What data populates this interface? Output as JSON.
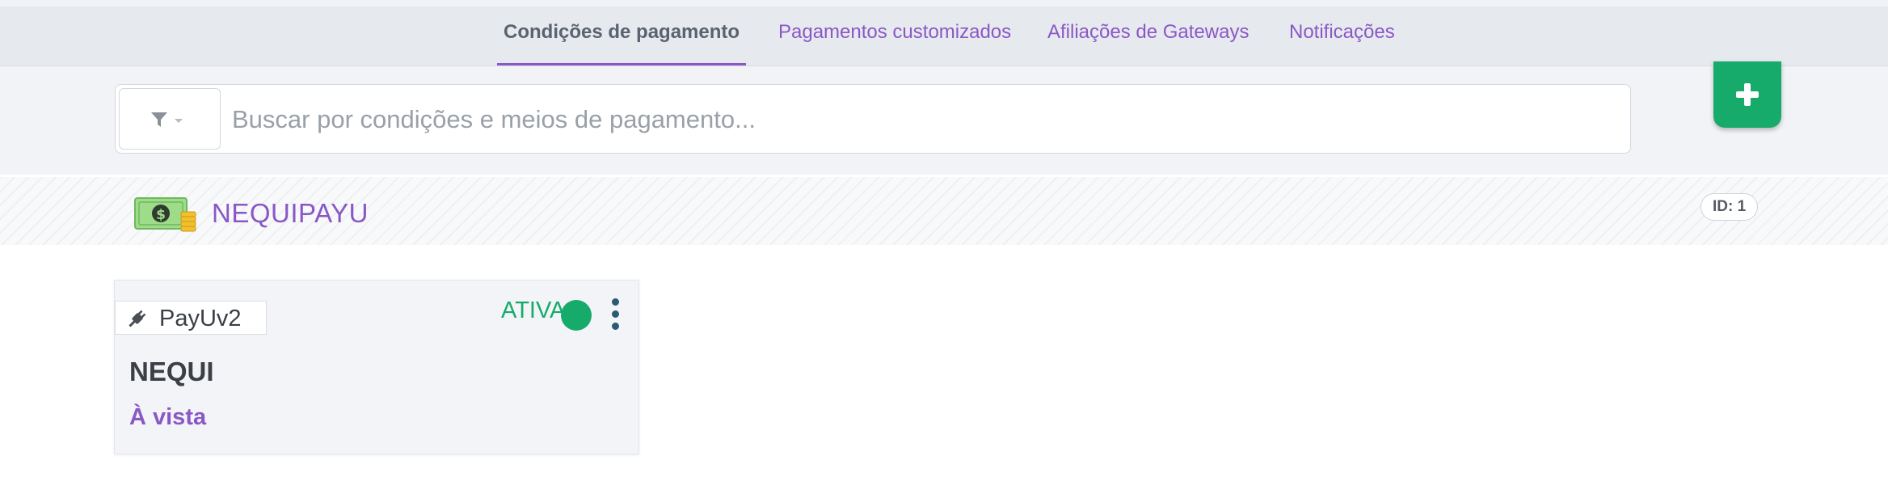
{
  "tabs": [
    {
      "label": "Condições de pagamento",
      "active": true
    },
    {
      "label": "Pagamentos customizados",
      "active": false
    },
    {
      "label": "Afiliações de Gateways",
      "active": false
    },
    {
      "label": "Notificações",
      "active": false
    }
  ],
  "search": {
    "placeholder": "Buscar por condições e meios de pagamento...",
    "value": "",
    "filter_icon": "filter-icon"
  },
  "add_button": {
    "icon": "plus-icon"
  },
  "group": {
    "icon": "money-icon",
    "title": "NEQUIPAYU",
    "id_badge": "ID: 1"
  },
  "card": {
    "gateway_icon": "plug-icon",
    "gateway": "PayUv2",
    "status": "ATIVA",
    "menu_icon": "kebab-menu-icon",
    "method": "NEQUI",
    "condition": "À vista"
  },
  "colors": {
    "accent": "#8a58c6",
    "success": "#17ab6b",
    "tab_bar": "#e6eaee",
    "text_dark": "#3c4046"
  }
}
